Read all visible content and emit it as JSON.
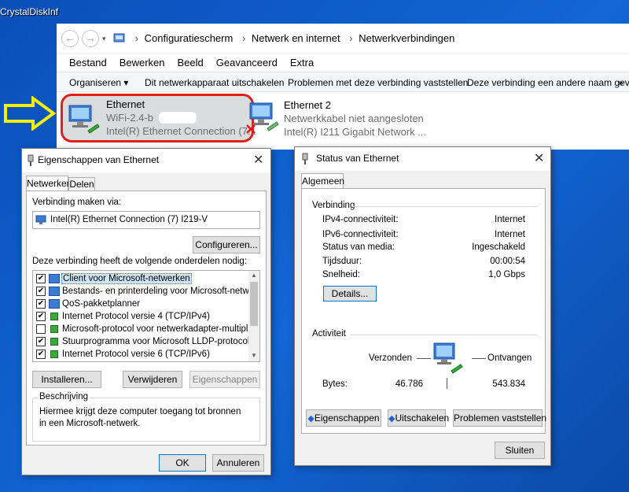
{
  "desktop": {
    "label": "CrystalDiskInf"
  },
  "explorer": {
    "breadcrumb": [
      "Configuratiescherm",
      "Netwerk en internet",
      "Netwerkverbindingen"
    ],
    "menu": [
      "Bestand",
      "Bewerken",
      "Beeld",
      "Geavanceerd",
      "Extra"
    ],
    "commands": {
      "organize": "Organiseren ▾",
      "disable": "Dit netwerkapparaat uitschakelen",
      "troubleshoot": "Problemen met deze verbinding vaststellen",
      "rename": "Deze verbinding een andere naam geven"
    },
    "items": [
      {
        "name": "Ethernet",
        "line1": "WiFi-2.4-b",
        "line2": "Intel(R) Ethernet Connection (7..."
      },
      {
        "name": "Ethernet 2",
        "line1": "Netwerkkabel niet aangesloten",
        "line2": "Intel(R) I211 Gigabit Network ..."
      }
    ]
  },
  "props": {
    "title": "Eigenschappen van Ethernet",
    "tabs": [
      "Netwerken",
      "Delen"
    ],
    "connect_label": "Verbinding maken via:",
    "adapter": "Intel(R) Ethernet Connection (7) I219-V",
    "configure": "Configureren...",
    "components_label": "Deze verbinding heeft de volgende onderdelen nodig:",
    "components": [
      {
        "label": "Client voor Microsoft-netwerken",
        "checked": "✔"
      },
      {
        "label": "Bestands- en printerdeling voor Microsoft-netwerken",
        "checked": "✔"
      },
      {
        "label": "QoS-pakketplanner",
        "checked": "✔"
      },
      {
        "label": "Internet Protocol versie 4 (TCP/IPv4)",
        "checked": "✔"
      },
      {
        "label": "Microsoft-protocol voor netwerkadapter-multiplexor",
        "checked": ""
      },
      {
        "label": "Stuurprogramma voor Microsoft LLDP-protocol",
        "checked": "✔"
      },
      {
        "label": "Internet Protocol versie 6 (TCP/IPv6)",
        "checked": "✔"
      }
    ],
    "install": "Installeren...",
    "uninstall": "Verwijderen",
    "properties": "Eigenschappen",
    "desc_label": "Beschrijving",
    "description": "Hiermee krijgt deze computer toegang tot bronnen in een Microsoft-netwerk.",
    "ok": "OK",
    "cancel": "Annuleren"
  },
  "status": {
    "title": "Status van Ethernet",
    "tab": "Algemeen",
    "connection_label": "Verbinding",
    "rows": [
      {
        "label": "IPv4-connectiviteit:",
        "value": "Internet"
      },
      {
        "label": "IPv6-connectiviteit:",
        "value": "Internet"
      },
      {
        "label": "Status van media:",
        "value": "Ingeschakeld"
      },
      {
        "label": "Tijdsduur:",
        "value": "00:00:54"
      },
      {
        "label": "Snelheid:",
        "value": "1,0 Gbps"
      }
    ],
    "details": "Details...",
    "activity_label": "Activiteit",
    "sent": "Verzonden",
    "received": "Ontvangen",
    "bytes_label": "Bytes:",
    "bytes_sent": "46.786",
    "bytes_received": "543.834",
    "btn_properties": "Eigenschappen",
    "btn_disable": "Uitschakelen",
    "btn_troubleshoot": "Problemen vaststellen",
    "close": "Sluiten"
  }
}
